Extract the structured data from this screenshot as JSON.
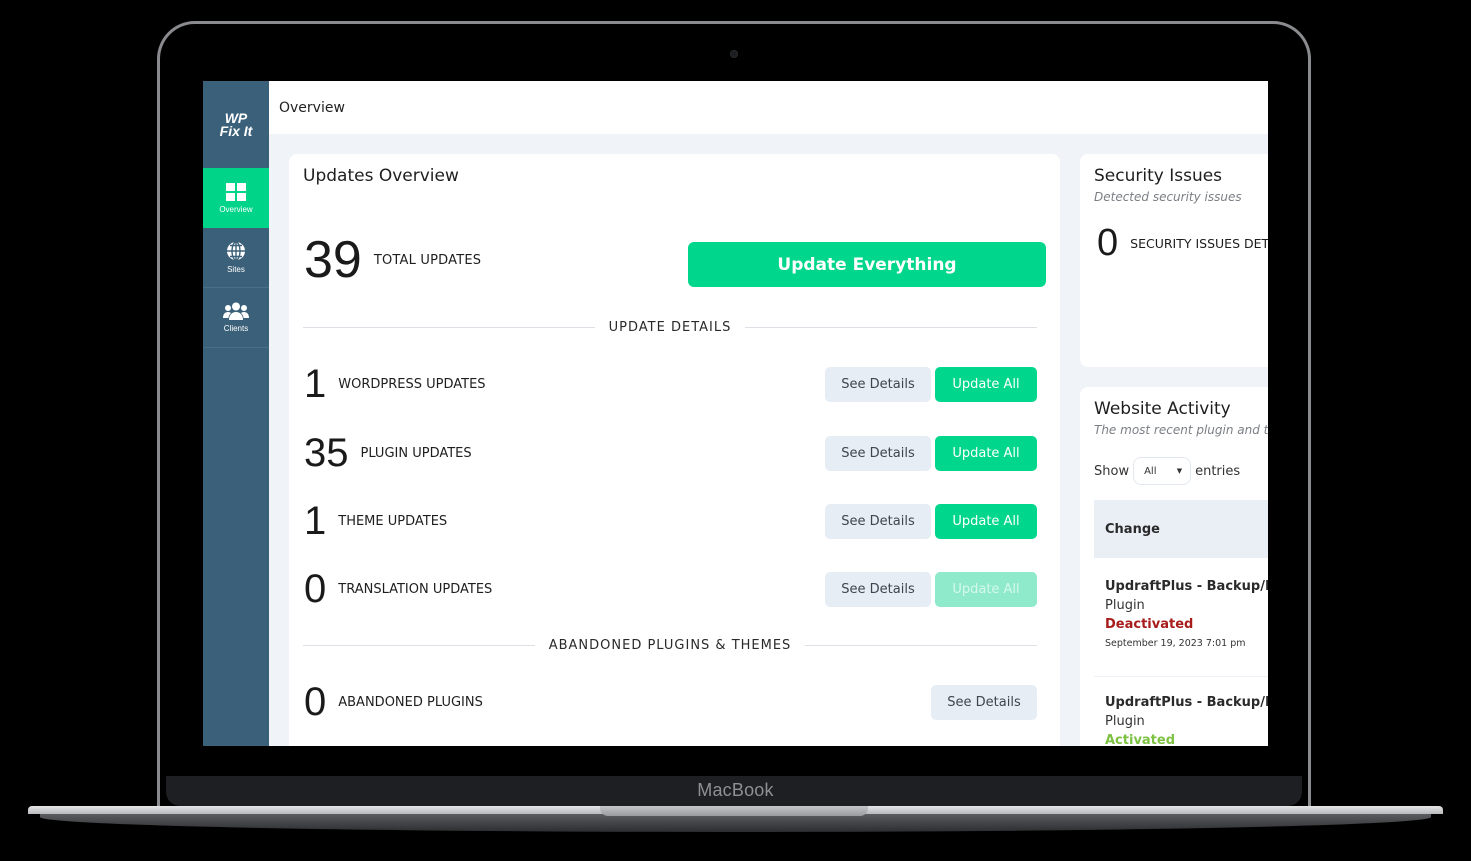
{
  "device": {
    "brand": "MacBook"
  },
  "sidebar": {
    "logo": [
      "WP",
      "Fix It"
    ],
    "items": [
      {
        "label": "Overview",
        "icon": "grid-icon",
        "active": true
      },
      {
        "label": "Sites",
        "icon": "globe-icon",
        "active": false
      },
      {
        "label": "Clients",
        "icon": "users-icon",
        "active": false
      }
    ]
  },
  "topbar": {
    "title": "Overview"
  },
  "updates": {
    "title": "Updates Overview",
    "total": {
      "count": "39",
      "label": "TOTAL UPDATES"
    },
    "update_everything_label": "Update Everything",
    "details_heading": "UPDATE DETAILS",
    "rows": [
      {
        "count": "1",
        "label": "WORDPRESS UPDATES",
        "see_label": "See Details",
        "update_label": "Update All",
        "update_enabled": true
      },
      {
        "count": "35",
        "label": "PLUGIN UPDATES",
        "see_label": "See Details",
        "update_label": "Update All",
        "update_enabled": true
      },
      {
        "count": "1",
        "label": "THEME UPDATES",
        "see_label": "See Details",
        "update_label": "Update All",
        "update_enabled": true
      },
      {
        "count": "0",
        "label": "TRANSLATION UPDATES",
        "see_label": "See Details",
        "update_label": "Update All",
        "update_enabled": false
      }
    ],
    "abandoned_heading": "ABANDONED PLUGINS & THEMES",
    "abandoned": {
      "count": "0",
      "label": "ABANDONED PLUGINS",
      "see_label": "See Details"
    }
  },
  "security": {
    "title": "Security Issues",
    "subtitle": "Detected security issues",
    "count": "0",
    "label": "SECURITY ISSUES DETECTED"
  },
  "activity": {
    "title": "Website Activity",
    "subtitle": "The most recent plugin and theme changes",
    "show_label": "Show",
    "entries_select": "All",
    "entries_label": "entries",
    "column_header": "Change",
    "entries": [
      {
        "name": "UpdraftPlus - Backup/Restore",
        "type": "Plugin",
        "status": "Deactivated",
        "status_color": "#a81c1c",
        "date": "September 19, 2023 7:01 pm"
      },
      {
        "name": "UpdraftPlus - Backup/Restore",
        "type": "Plugin",
        "status": "Activated",
        "status_color": "#7cc142",
        "date": ""
      }
    ]
  },
  "colors": {
    "accent": "#00d68c",
    "accent_disabled": "#8eeacb",
    "sidebar": "#3b6079",
    "background": "#f0f4f8"
  }
}
